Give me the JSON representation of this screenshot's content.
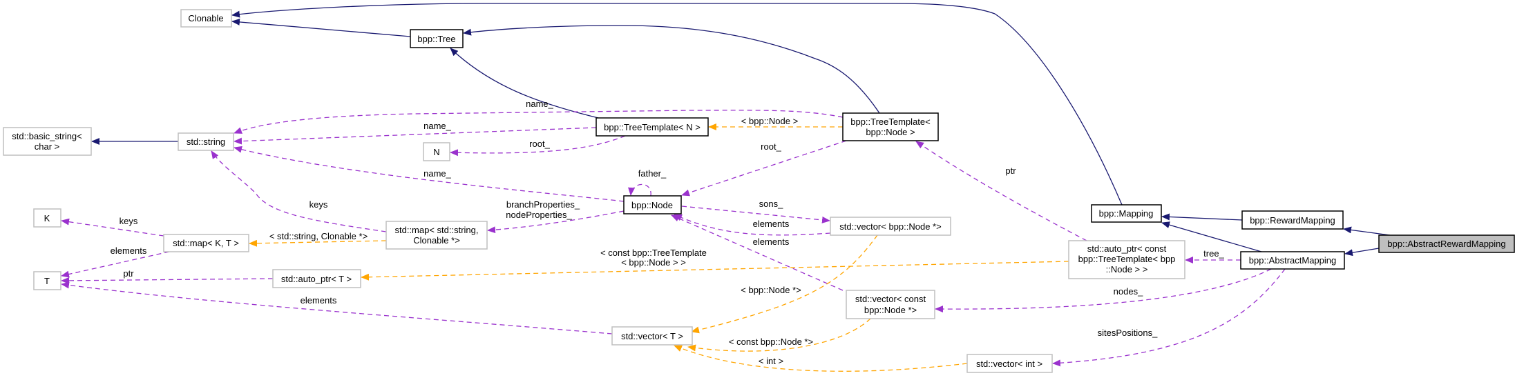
{
  "colors": {
    "inheritance": "#191970",
    "usage": "#9a32cd",
    "template": "#ffa500",
    "focus_fill": "#bfbfbf",
    "external_border": "#bfbfbf"
  },
  "nodes": {
    "clonable": {
      "lines": [
        "Clonable"
      ]
    },
    "tree": {
      "lines": [
        "bpp::Tree"
      ]
    },
    "basic_string": {
      "lines": [
        "std::basic_string<",
        "char >"
      ]
    },
    "string": {
      "lines": [
        "std::string"
      ]
    },
    "n": {
      "lines": [
        "N"
      ]
    },
    "tt_n": {
      "lines": [
        "bpp::TreeTemplate< N >"
      ]
    },
    "tt_node": {
      "lines": [
        "bpp::TreeTemplate<",
        "bpp::Node >"
      ]
    },
    "node": {
      "lines": [
        "bpp::Node"
      ]
    },
    "k": {
      "lines": [
        "K"
      ]
    },
    "t": {
      "lines": [
        "T"
      ]
    },
    "map_kt": {
      "lines": [
        "std::map< K, T >"
      ]
    },
    "map_sc": {
      "lines": [
        "std::map< std::string,",
        "Clonable *>"
      ]
    },
    "autoptr_t": {
      "lines": [
        "std::auto_ptr< T >"
      ]
    },
    "vec_node": {
      "lines": [
        "std::vector< bpp::Node *>"
      ]
    },
    "vec_const": {
      "lines": [
        "std::vector< const",
        "bpp::Node *>"
      ]
    },
    "vec_t": {
      "lines": [
        "std::vector< T >"
      ]
    },
    "vec_int": {
      "lines": [
        "std::vector< int >"
      ]
    },
    "mapping": {
      "lines": [
        "bpp::Mapping"
      ]
    },
    "reward": {
      "lines": [
        "bpp::RewardMapping"
      ]
    },
    "abstract": {
      "lines": [
        "bpp::AbstractMapping"
      ]
    },
    "arm": {
      "lines": [
        "bpp::AbstractRewardMapping"
      ]
    },
    "autoptr_c": {
      "lines": [
        "std::auto_ptr< const",
        "bpp::TreeTemplate< bpp",
        "::Node > >"
      ]
    }
  },
  "edge_labels": {
    "tt_node_name": "name_",
    "tt_n_name": "name_",
    "tt_n_root": "root_",
    "node_name": "name_",
    "tt_node_root": "root_",
    "father": "father_",
    "branch_props": "branchProperties_",
    "node_props": "nodeProperties_",
    "map_keys": "keys",
    "sons": "sons_",
    "vec_node_elements": "elements",
    "vec_const_elements": "elements",
    "mapkt_keys": "keys",
    "mapkt_elements": "elements",
    "autoptr_ptr": "ptr",
    "vect_elements": "elements",
    "autoptrc_ptr": "ptr",
    "tree": "tree_",
    "nodes": "nodes_",
    "sites": "sitesPositions_",
    "tpl_node": "< bpp::Node >",
    "tpl_map": "< std::string, Clonable *>",
    "tpl_autoptr_1": "< const bpp::TreeTemplate",
    "tpl_autoptr_2": "< bpp::Node > >",
    "tpl_vec_node": "< bpp::Node *>",
    "tpl_vec_const": "< const bpp::Node *>",
    "tpl_int": "< int >"
  }
}
